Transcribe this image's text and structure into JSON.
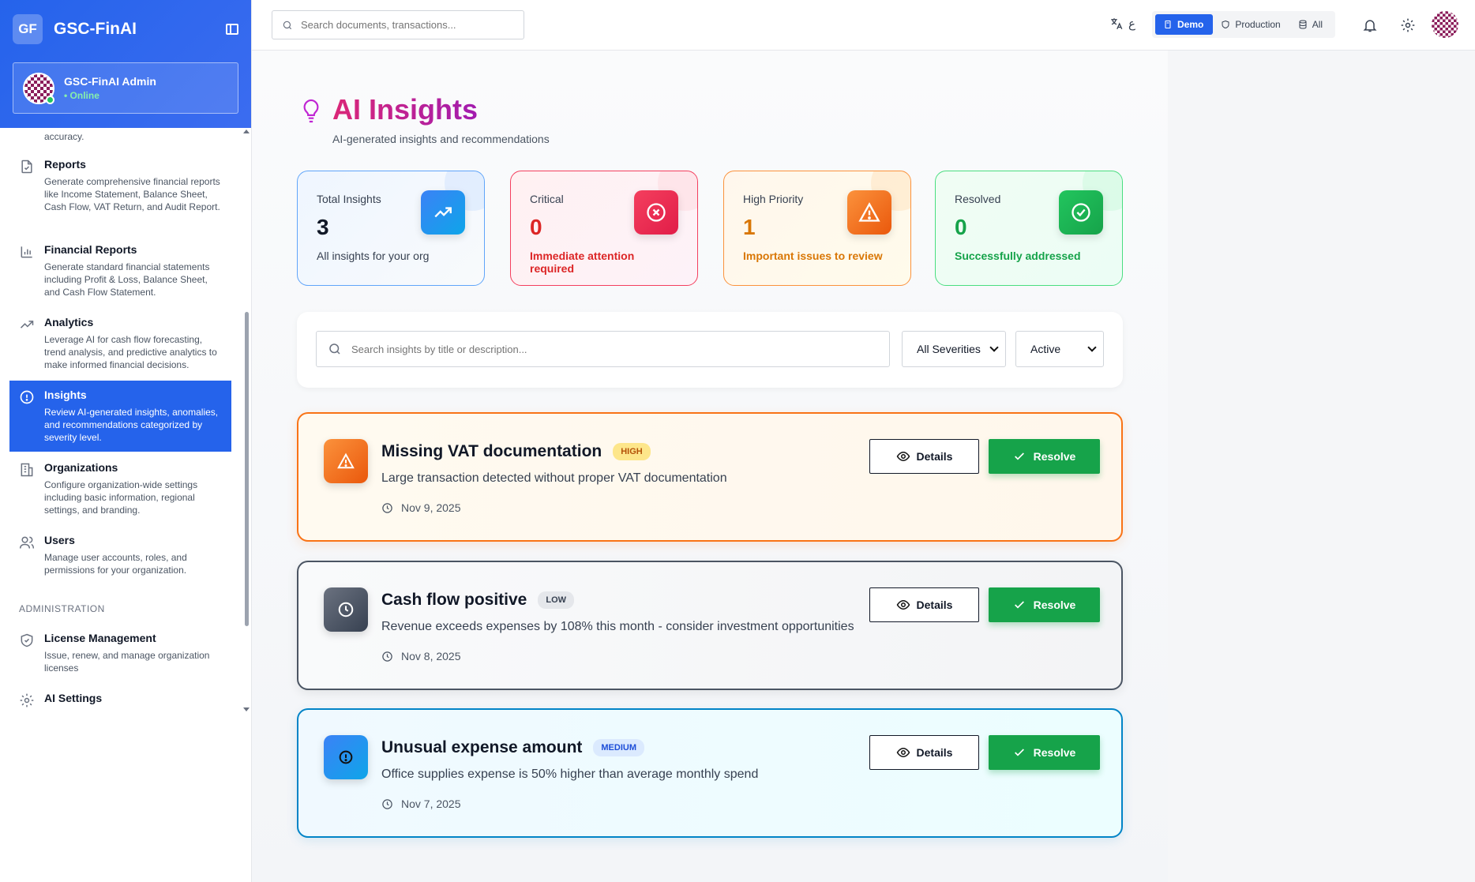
{
  "app": {
    "logo": "GF",
    "name": "GSC-FinAI"
  },
  "user": {
    "name": "GSC-FinAI Admin",
    "status": "• Online"
  },
  "sidebar": {
    "cut_text": "accuracy.",
    "items": [
      {
        "title": "Reports",
        "desc": "Generate comprehensive financial reports like Income Statement, Balance Sheet, Cash Flow, VAT Return, and Audit Report.",
        "icon": "file-check-icon"
      },
      {
        "title": "Financial Reports",
        "desc": "Generate standard financial statements including Profit & Loss, Balance Sheet, and Cash Flow Statement.",
        "icon": "bar-chart-icon"
      },
      {
        "title": "Analytics",
        "desc": "Leverage AI for cash flow forecasting, trend analysis, and predictive analytics to make informed financial decisions.",
        "icon": "trending-up-icon"
      },
      {
        "title": "Insights",
        "desc": "Review AI-generated insights, anomalies, and recommendations categorized by severity level.",
        "icon": "alert-circle-icon"
      },
      {
        "title": "Organizations",
        "desc": "Configure organization-wide settings including basic information, regional settings, and branding.",
        "icon": "building-icon"
      },
      {
        "title": "Users",
        "desc": "Manage user accounts, roles, and permissions for your organization.",
        "icon": "users-icon"
      }
    ],
    "admin_label": "ADMINISTRATION",
    "admin_items": [
      {
        "title": "License Management",
        "desc": "Issue, renew, and manage organization licenses",
        "icon": "shield-check-icon"
      },
      {
        "title": "AI Settings",
        "desc": "",
        "icon": "gear-icon"
      }
    ]
  },
  "topbar": {
    "search_placeholder": "Search documents, transactions...",
    "lang_glyph": "ع",
    "env": {
      "demo": "Demo",
      "production": "Production",
      "all": "All"
    }
  },
  "page": {
    "title": "AI Insights",
    "subtitle": "AI-generated insights and recommendations"
  },
  "stats": [
    {
      "label": "Total Insights",
      "value": "3",
      "note": "All insights for your org",
      "color": "#2563eb"
    },
    {
      "label": "Critical",
      "value": "0",
      "note": "Immediate attention required",
      "color": "#e11d48"
    },
    {
      "label": "High Priority",
      "value": "1",
      "note": "Important issues to review",
      "color": "#f97316"
    },
    {
      "label": "Resolved",
      "value": "0",
      "note": "Successfully addressed",
      "color": "#16a34a"
    }
  ],
  "filters": {
    "search_placeholder": "Search insights by title or description...",
    "severity": "All Severities",
    "status": "Active"
  },
  "insights": [
    {
      "title": "Missing VAT documentation",
      "badge": "HIGH",
      "desc": "Large transaction detected without proper VAT documentation",
      "date": "Nov 9, 2025"
    },
    {
      "title": "Cash flow positive",
      "badge": "LOW",
      "desc": "Revenue exceeds expenses by 108% this month - consider investment opportunities",
      "date": "Nov 8, 2025"
    },
    {
      "title": "Unusual expense amount",
      "badge": "MEDIUM",
      "desc": "Office supplies expense is 50% higher than average monthly spend",
      "date": "Nov 7, 2025"
    }
  ],
  "actions": {
    "details": "Details",
    "resolve": "Resolve"
  }
}
